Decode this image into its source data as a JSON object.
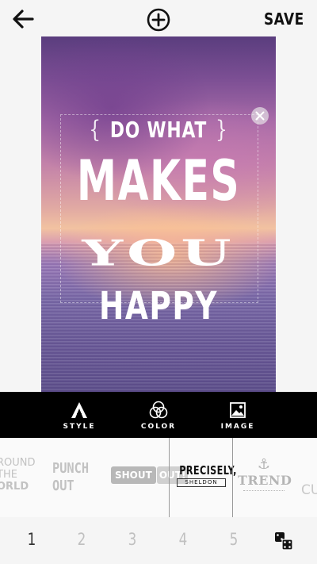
{
  "topbar": {
    "back_icon": "arrow-left-icon",
    "add_icon": "plus-circle-icon",
    "save_label": "SAVE"
  },
  "poster": {
    "line1": "DO WHAT",
    "line1_brace_open": "{",
    "line1_brace_close": "}",
    "line2": "MAKES",
    "line3": "YOU",
    "line4": "HAPPY",
    "text_color": "#ffffff",
    "close_icon": "close-icon"
  },
  "tabs": [
    {
      "label": "STYLE",
      "icon": "style-a-icon"
    },
    {
      "label": "COLOR",
      "icon": "color-circles-icon"
    },
    {
      "label": "IMAGE",
      "icon": "image-icon"
    }
  ],
  "font_options": {
    "around": {
      "line1": "ROUND",
      "line2": "THE",
      "line3": "ORLD"
    },
    "punch": {
      "line1": "PUNCH",
      "line2": "OUT"
    },
    "shout": {
      "part1": "SHOUT",
      "part2": "OUT!"
    },
    "precisely": {
      "line1": "PRECISELY,",
      "line2": "SHELDON"
    },
    "trend": {
      "icon": "anchor-icon",
      "label": "TREND"
    },
    "cur": {
      "label": "CU"
    }
  },
  "pages": {
    "items": [
      "1",
      "2",
      "3",
      "4",
      "5"
    ],
    "active": "1",
    "random_icon": "dice-icon"
  },
  "colors": {
    "tabbar_bg": "#000000",
    "background": "#f5f5f5"
  }
}
